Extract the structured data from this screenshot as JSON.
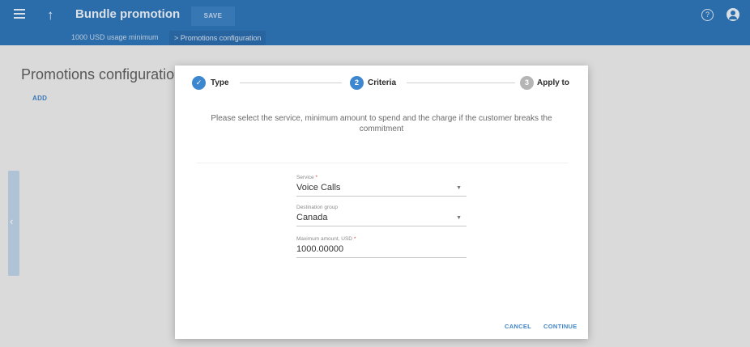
{
  "header": {
    "title": "Bundle promotion",
    "save_label": "SAVE",
    "menu_icon": "hamburger-icon",
    "up_icon": "arrow-up-icon",
    "help_icon": "help-circle-icon",
    "user_icon": "account-icon",
    "accent_color": "#2e74b5"
  },
  "breadcrumb": {
    "items": [
      "1000 USD usage minimum",
      "Promotions configuration"
    ],
    "separator": ">"
  },
  "page": {
    "title": "Promotions configuration",
    "add_label": "ADD",
    "collapse_icon": "chevron-left-icon"
  },
  "dialog": {
    "steps": [
      {
        "number": "✓",
        "label": "Type",
        "state": "complete"
      },
      {
        "number": "2",
        "label": "Criteria",
        "state": "active"
      },
      {
        "number": "3",
        "label": "Apply to",
        "state": "pending"
      }
    ],
    "instructions": "Please select the service, minimum amount to spend and the charge if the customer breaks the commitment",
    "fields": [
      {
        "label": "Service",
        "required": "*",
        "value": "Voice Calls",
        "has_dropdown": true
      },
      {
        "label": "Destination group",
        "required": "",
        "value": "Canada",
        "has_dropdown": true
      },
      {
        "label": "Maximum amount, USD",
        "required": "*",
        "value": "1000.00000",
        "has_dropdown": false
      }
    ],
    "cancel_label": "CANCEL",
    "continue_label": "CONTINUE"
  }
}
